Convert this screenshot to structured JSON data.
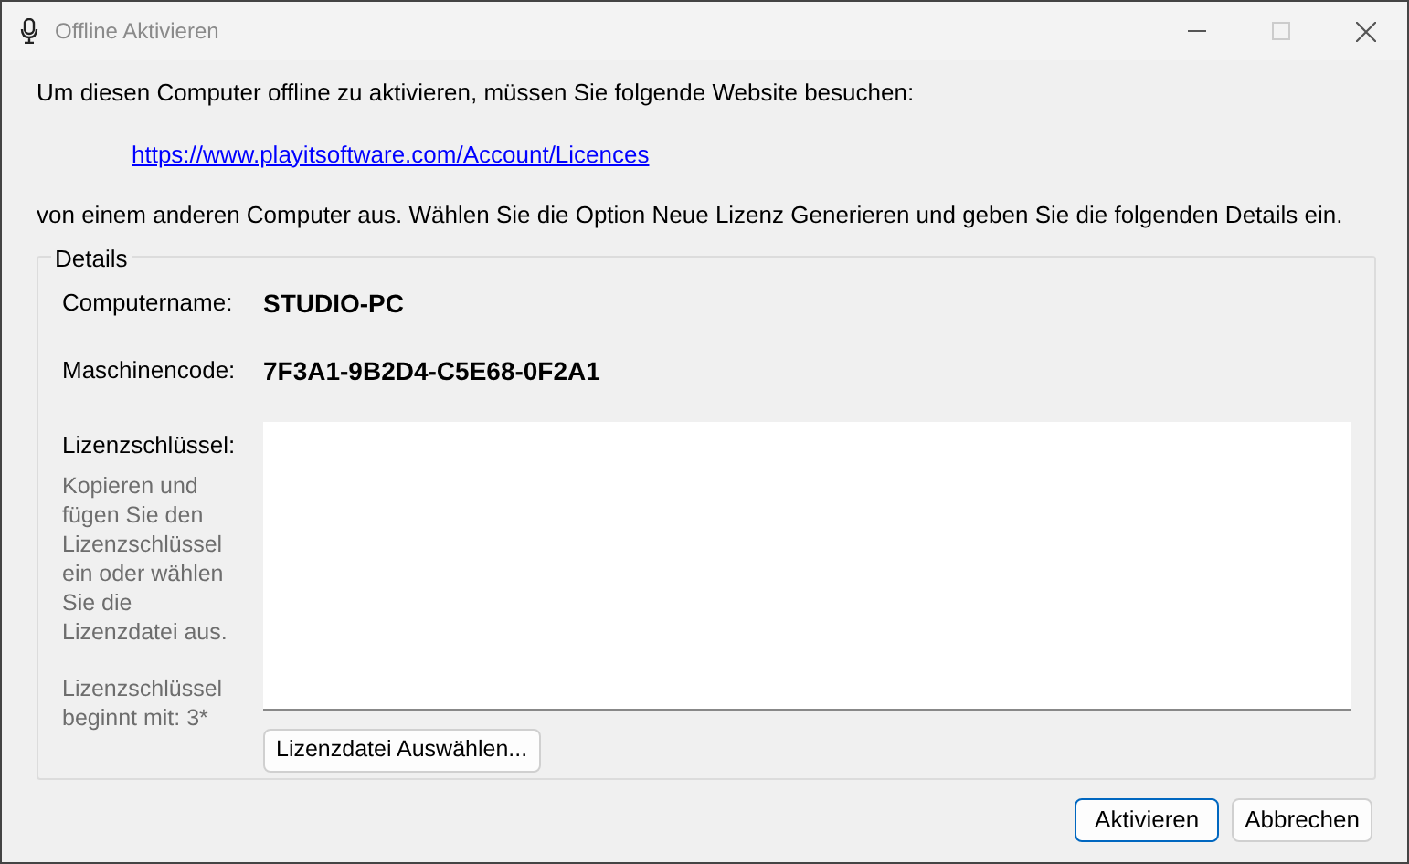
{
  "window": {
    "title": "Offline Aktivieren"
  },
  "intro": "Um diesen Computer offline zu aktivieren, müssen Sie folgende Website besuchen:",
  "link": "https://www.playitsoftware.com/Account/Licences",
  "instructions": "von einem anderen Computer aus. Wählen Sie die Option Neue Lizenz Generieren und geben Sie die folgenden Details ein.",
  "details": {
    "title": "Details",
    "fields": [
      {
        "label": "Computername:",
        "value": "STUDIO-PC"
      },
      {
        "label": "Maschinencode:",
        "value": "7F3A1-9B2D4-C5E68-0F2A1"
      }
    ],
    "license_label": "Lizenzschlüssel:",
    "license_help": "Kopieren und fügen Sie den Lizenzschlüssel ein oder wählen Sie die Lizenzdatei aus.",
    "license_hint": "Lizenzschlüssel beginnt mit: 3*",
    "browse_button": "Lizenzdatei Auswählen..."
  },
  "buttons": [
    {
      "label": "Aktivieren",
      "default": true
    },
    {
      "label": "Abbrechen",
      "default": false
    }
  ]
}
